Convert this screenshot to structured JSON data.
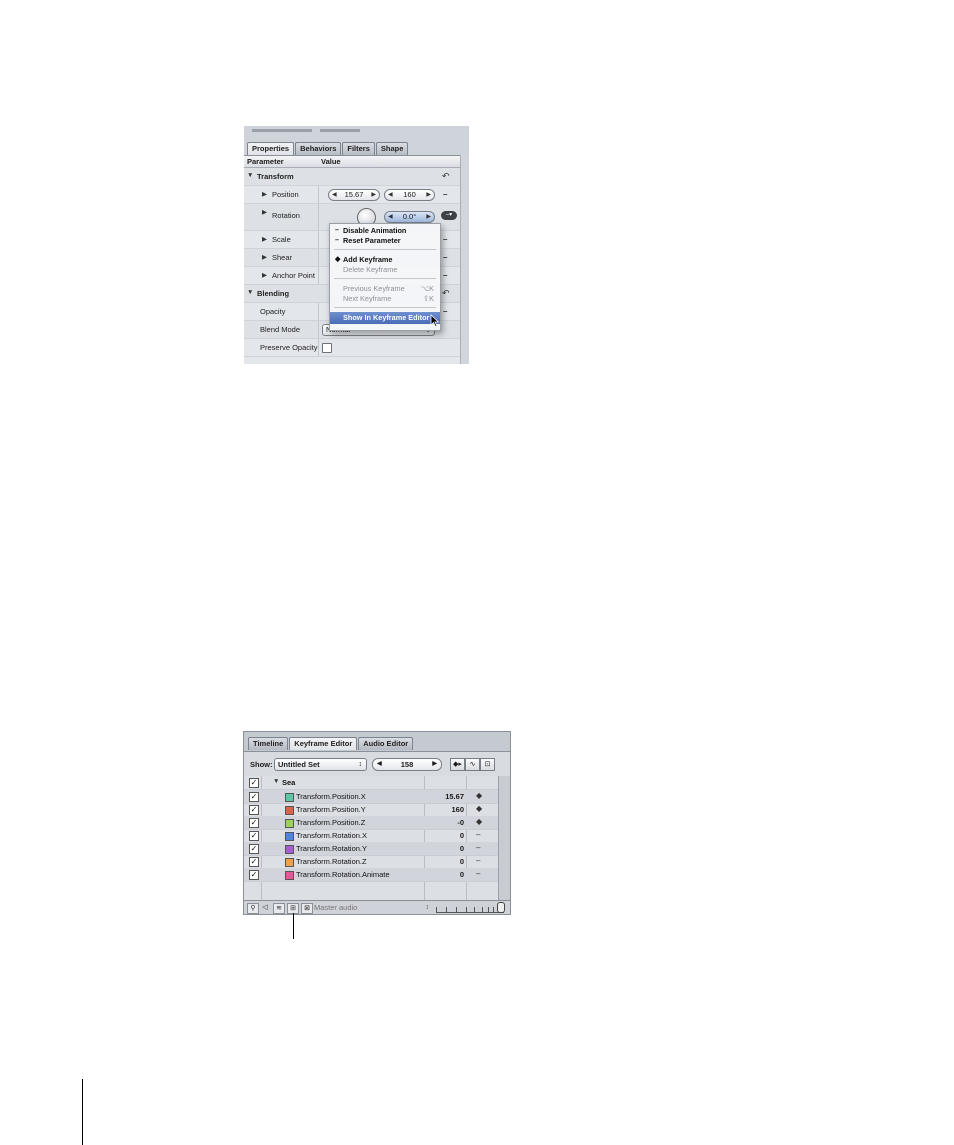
{
  "inspector": {
    "tabs": [
      "Properties",
      "Behaviors",
      "Filters",
      "Shape"
    ],
    "columns": {
      "parameter": "Parameter",
      "value": "Value"
    },
    "rows": {
      "transform": "Transform",
      "position": "Position",
      "position_x": "15.67",
      "position_y": "160",
      "rotation": "Rotation",
      "rotation_value": "0.0°",
      "scale": "Scale",
      "shear": "Shear",
      "anchor_point": "Anchor Point",
      "blending": "Blending",
      "opacity": "Opacity",
      "blend_mode": "Blend Mode",
      "blend_mode_value": "Normal",
      "preserve_opacity": "Preserve Opacity"
    },
    "context_menu": {
      "disable_animation": "Disable Animation",
      "reset_parameter": "Reset Parameter",
      "add_keyframe": "Add Keyframe",
      "delete_keyframe": "Delete Keyframe",
      "previous_keyframe": "Previous Keyframe",
      "previous_shortcut": "⌥K",
      "next_keyframe": "Next Keyframe",
      "next_shortcut": "⇧K",
      "show_in_keyframe_editor": "Show In Keyframe Editor"
    }
  },
  "timing": {
    "tabs": [
      "Timeline",
      "Keyframe Editor",
      "Audio Editor"
    ],
    "show_label": "Show:",
    "show_value": "Untitled Set",
    "frame_value": "158",
    "group": "Sea",
    "channels": [
      {
        "name": "Transform.Position.X",
        "value": "15.67",
        "mark": "◆",
        "color": "#5fc4a4"
      },
      {
        "name": "Transform.Position.Y",
        "value": "160",
        "mark": "◆",
        "color": "#d2684a"
      },
      {
        "name": "Transform.Position.Z",
        "value": "-0",
        "mark": "◆",
        "color": "#9bd35a"
      },
      {
        "name": "Transform.Rotation.X",
        "value": "0",
        "mark": "–",
        "color": "#4f86d8"
      },
      {
        "name": "Transform.Rotation.Y",
        "value": "0",
        "mark": "–",
        "color": "#a85bd2"
      },
      {
        "name": "Transform.Rotation.Z",
        "value": "0",
        "mark": "–",
        "color": "#f0a04a"
      },
      {
        "name": "Transform.Rotation.Animate",
        "value": "0",
        "mark": "–",
        "color": "#e05a9a"
      }
    ],
    "master_audio": "Master audio"
  }
}
